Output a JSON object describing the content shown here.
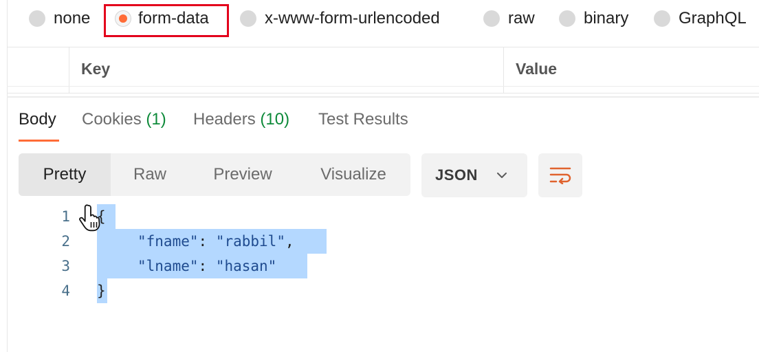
{
  "body_types": [
    {
      "label": "none",
      "selected": false
    },
    {
      "label": "form-data",
      "selected": true
    },
    {
      "label": "x-www-form-urlencoded",
      "selected": false
    },
    {
      "label": "raw",
      "selected": false
    },
    {
      "label": "binary",
      "selected": false
    },
    {
      "label": "GraphQL",
      "selected": false
    }
  ],
  "params_table": {
    "headers": [
      "Key",
      "Value"
    ]
  },
  "response_tabs": [
    {
      "label": "Body",
      "count": "",
      "active": true
    },
    {
      "label": "Cookies",
      "count": "(1)",
      "active": false
    },
    {
      "label": "Headers",
      "count": "(10)",
      "active": false
    },
    {
      "label": "Test Results",
      "count": "",
      "active": false
    }
  ],
  "view_modes": [
    "Pretty",
    "Raw",
    "Preview",
    "Visualize"
  ],
  "active_view": "Pretty",
  "format": "JSON",
  "code": {
    "line_numbers": [
      "1",
      "2",
      "3",
      "4"
    ],
    "open_brace": "{",
    "close_brace": "}",
    "fields": [
      {
        "key": "\"fname\"",
        "colon": ": ",
        "value": "\"rabbil\"",
        "suffix": ","
      },
      {
        "key": "\"lname\"",
        "colon": ": ",
        "value": "\"hasan\"",
        "suffix": ""
      }
    ]
  },
  "colors": {
    "accent": "#ff6c37",
    "highlight_box": "#e3001b",
    "selection": "#b4d8ff",
    "count_green": "#0e8a3a"
  },
  "icons": [
    "chevron-down-icon",
    "wrap-lines-icon",
    "hand-cursor-icon"
  ]
}
